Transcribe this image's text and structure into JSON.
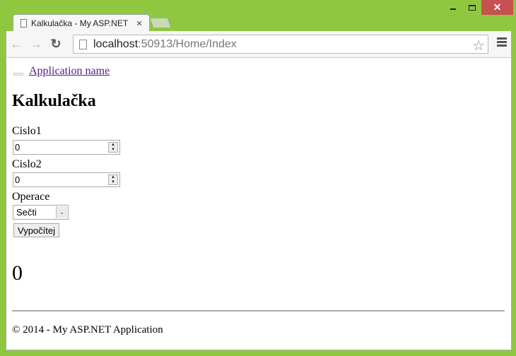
{
  "window": {
    "controls": {
      "minimize": "minimize",
      "maximize": "maximize",
      "close": "✕"
    }
  },
  "browser": {
    "tab": {
      "title": "Kalkulačka - My ASP.NET",
      "close": "✕"
    },
    "nav": {
      "back": "←",
      "forward": "→",
      "reload": "↻"
    },
    "url": {
      "host": "localhost",
      "rest": ":50913/Home/Index"
    },
    "star": "☆"
  },
  "page": {
    "brand": "Application name",
    "heading": "Kalkulačka",
    "form": {
      "cislo1_label": "Cislo1",
      "cislo1_value": "0",
      "cislo2_label": "Cislo2",
      "cislo2_value": "0",
      "operace_label": "Operace",
      "operace_selected": "Sečti",
      "submit_label": "Vypočítej"
    },
    "result": "0",
    "footer": "© 2014 - My ASP.NET Application"
  }
}
